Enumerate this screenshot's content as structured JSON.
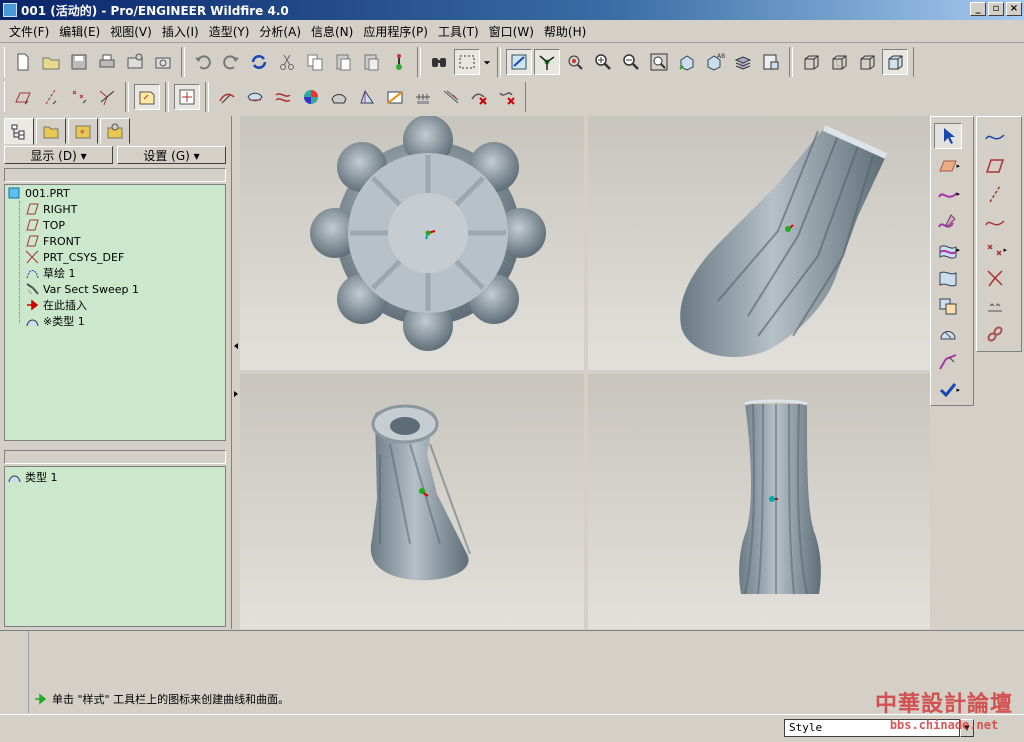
{
  "window": {
    "title": "001 (活动的) - Pro/ENGINEER Wildfire 4.0",
    "minimize": "_",
    "restore": "▫",
    "close": "×"
  },
  "menu": [
    "文件(F)",
    "编辑(E)",
    "视图(V)",
    "插入(I)",
    "造型(Y)",
    "分析(A)",
    "信息(N)",
    "应用程序(P)",
    "工具(T)",
    "窗口(W)",
    "帮助(H)"
  ],
  "nav": {
    "show_label": "显示 (D) ▾",
    "settings_label": "设置 (G) ▾",
    "tree": [
      "001.PRT",
      "RIGHT",
      "TOP",
      "FRONT",
      "PRT_CSYS_DEF",
      "草绘 1",
      "Var Sect Sweep 1",
      "在此插入",
      "※类型 1"
    ],
    "lower_item": "类型 1"
  },
  "message": {
    "text": "单击 \"样式\" 工具栏上的图标来创建曲线和曲面。"
  },
  "status": {
    "filter": "Style"
  },
  "watermark": {
    "line1": "中華設計論壇",
    "line2": "bbs.chinade.net"
  },
  "colors": {
    "tree_bg": "#cce8cc",
    "model": "#8f9da6",
    "title_start": "#0a246a"
  }
}
